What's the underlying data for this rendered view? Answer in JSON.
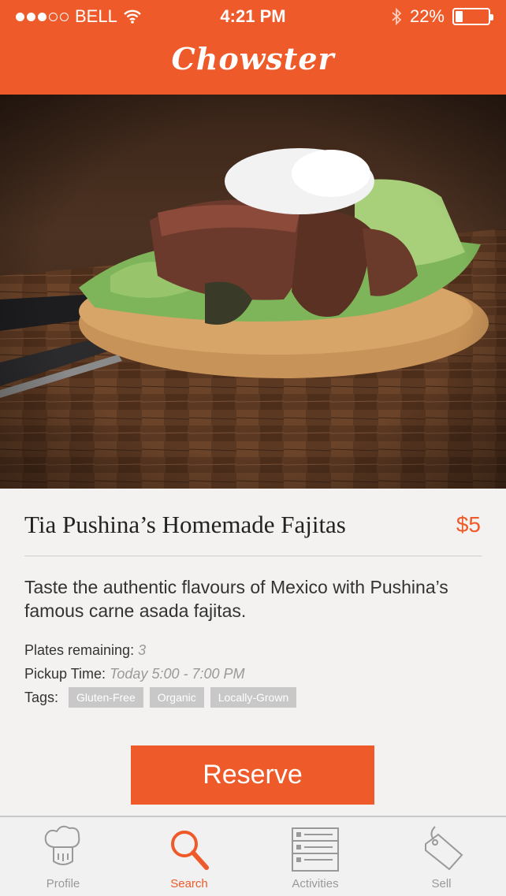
{
  "status_bar": {
    "carrier": "BELL",
    "time": "4:21 PM",
    "battery": "22%",
    "battery_level": 0.22
  },
  "app": {
    "title": "Chowster"
  },
  "listing": {
    "title": "Tia Pushina’s Homemade Fajitas",
    "price": "$5",
    "description": "Taste the authentic flavours of Mexico with Pushina’s famous carne asada fajitas.",
    "plates_label": "Plates remaining:",
    "plates_value": "3",
    "pickup_label": "Pickup Time:",
    "pickup_value": "Today 5:00 - 7:00 PM",
    "tags_label": "Tags:",
    "tags": [
      "Gluten-Free",
      "Organic",
      "Locally-Grown"
    ],
    "reserve_label": "Reserve"
  },
  "tabbar": {
    "items": [
      {
        "label": "Profile",
        "icon": "chef-hat-icon",
        "active": false
      },
      {
        "label": "Search",
        "icon": "search-icon",
        "active": true
      },
      {
        "label": "Activities",
        "icon": "list-icon",
        "active": false
      },
      {
        "label": "Sell",
        "icon": "tag-icon",
        "active": false
      }
    ]
  },
  "colors": {
    "accent": "#ee5a29",
    "background": "#f3f2f0",
    "tag_bg": "#c8c8c8"
  }
}
